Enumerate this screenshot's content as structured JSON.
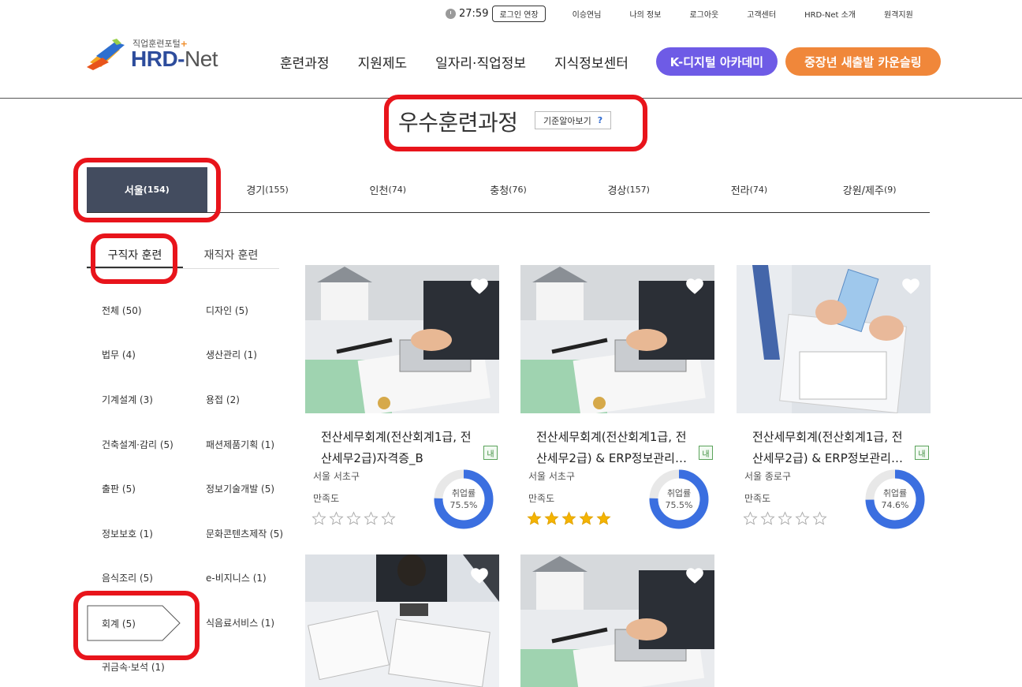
{
  "util": {
    "time": "27:59",
    "extend_label": "로그인 연장",
    "links": [
      "이승연님",
      "나의 정보",
      "로그아웃",
      "고객센터",
      "HRD-Net 소개",
      "원격지원"
    ]
  },
  "logo": {
    "small": "직업훈련포털",
    "plus": "+",
    "brand": "HRD-",
    "brand2": "Net"
  },
  "nav": {
    "items": [
      "훈련과정",
      "지원제도",
      "일자리·직업정보",
      "지식정보센터"
    ],
    "k_digital": "K-디지털 아카데미",
    "midcareer": "중장년 새출발 카운슬링"
  },
  "page": {
    "title": "우수훈련과정",
    "criteria": "기준알아보기",
    "criteria_q": "?"
  },
  "regions": [
    {
      "name": "서울",
      "count": "(154)",
      "active": true
    },
    {
      "name": "경기",
      "count": "(155)"
    },
    {
      "name": "인천",
      "count": "(74)"
    },
    {
      "name": "충청",
      "count": "(76)"
    },
    {
      "name": "경상",
      "count": "(157)"
    },
    {
      "name": "전라",
      "count": "(74)"
    },
    {
      "name": "강원/제주",
      "count": "(9)"
    }
  ],
  "training_tabs": [
    "구직자 훈련",
    "재직자 훈련"
  ],
  "categories": {
    "left": [
      "전체 (50)",
      "법무 (4)",
      "기계설계 (3)",
      "건축설계·감리 (5)",
      "출판 (5)",
      "정보보호 (1)",
      "음식조리 (5)",
      "회계 (5)",
      "귀금속·보석 (1)"
    ],
    "right": [
      "디자인 (5)",
      "생산관리 (1)",
      "용접 (2)",
      "패션제품기획 (1)",
      "정보기술개발 (5)",
      "문화콘텐츠제작 (5)",
      "e-비지니스 (1)",
      "식음료서비스 (1)"
    ]
  },
  "cards": [
    {
      "title": "전산세무회계(전산회계1급, 전산세무2급)자격증_B",
      "badge": "내",
      "location": "서울 서초구",
      "sat_label": "만족도",
      "stars": 0,
      "rate_label": "취업률",
      "rate": "75.5%",
      "rate_value": 75.5
    },
    {
      "title": "전산세무회계(전산회계1급, 전산세무2급) & ERP정보관리…",
      "badge": "내",
      "location": "서울 서초구",
      "sat_label": "만족도",
      "stars": 5,
      "rate_label": "취업률",
      "rate": "75.5%",
      "rate_value": 75.5
    },
    {
      "title": "전산세무회계(전산회계1급, 전산세무2급) & ERP정보관리…",
      "badge": "내",
      "location": "서울 종로구",
      "sat_label": "만족도",
      "stars": 0,
      "rate_label": "취업률",
      "rate": "74.6%",
      "rate_value": 74.6
    }
  ],
  "colors": {
    "accent_blue": "#3b6fe0",
    "k_digital": "#6e5be6",
    "midcareer": "#f0873a",
    "active_tab": "#434c5f",
    "highlight": "#e8141b"
  }
}
